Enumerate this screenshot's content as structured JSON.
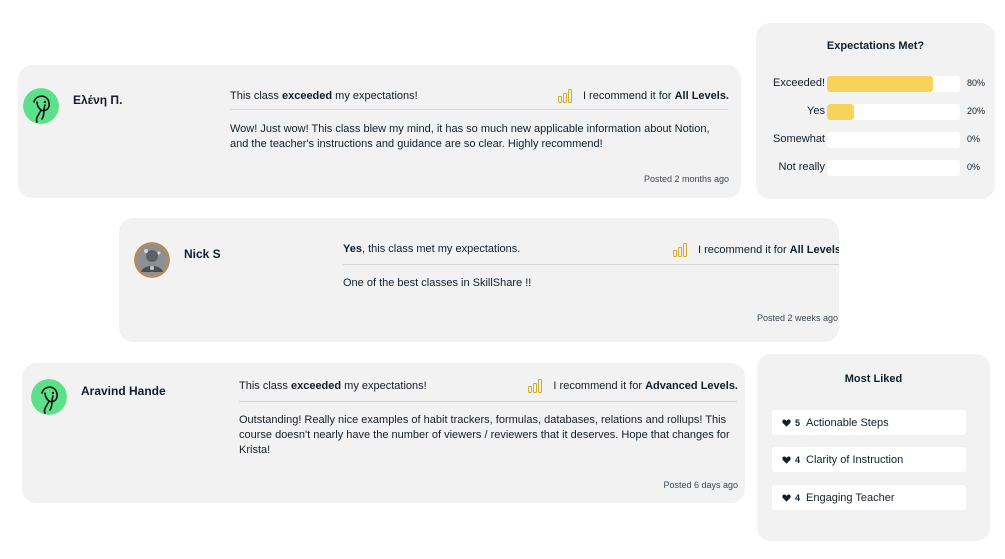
{
  "reviews": [
    {
      "author": "Ελένη Π.",
      "headline_pre": "This class ",
      "headline_bold": "exceeded",
      "headline_post": " my expectations!",
      "recommend_pre": "I recommend it for",
      "recommend_bold": "All Levels.",
      "body": "Wow! Just wow! This class blew my mind, it has so much new applicable information about Notion, and the teacher's instructions and guidance are so clear. Highly recommend!",
      "posted": "Posted 2 months ago"
    },
    {
      "author": "Nick S",
      "headline_pre": "",
      "headline_bold": "Yes",
      "headline_post": ", this class met my expectations.",
      "recommend_pre": "I recommend it for",
      "recommend_bold": "All Levels.",
      "body": "One of the best classes in SkillShare !!",
      "posted": "Posted 2 weeks ago"
    },
    {
      "author": "Aravind Hande",
      "headline_pre": "This class ",
      "headline_bold": "exceeded",
      "headline_post": " my expectations!",
      "recommend_pre": "I recommend it for",
      "recommend_bold": "Advanced Levels.",
      "body": "Outstanding! Really nice examples of habit trackers, formulas, databases, relations and rollups! This course doesn't nearly have the number of viewers / reviewers that it deserves. Hope that changes for Krista!",
      "posted": "Posted 6 days ago"
    }
  ],
  "expectations": {
    "title": "Expectations Met?",
    "bar_color": "#f6d35a",
    "rows": [
      {
        "label": "Exceeded!",
        "percent": 80,
        "display": "80%"
      },
      {
        "label": "Yes",
        "percent": 20,
        "display": "20%"
      },
      {
        "label": "Somewhat",
        "percent": 0,
        "display": "0%"
      },
      {
        "label": "Not really",
        "percent": 0,
        "display": "0%"
      }
    ]
  },
  "most_liked": {
    "title": "Most Liked",
    "items": [
      {
        "count": "5",
        "label": "Actionable Steps"
      },
      {
        "count": "4",
        "label": "Clarity of Instruction"
      },
      {
        "count": "4",
        "label": "Engaging Teacher"
      }
    ]
  },
  "icons": {
    "level": "signal-bars-icon",
    "heart": "heart-icon",
    "avatar_line_art": "line-art-face-avatar",
    "avatar_photo": "user-photo-avatar"
  },
  "colors": {
    "card_bg": "#f2f2f2",
    "avatar_green": "#5ce08a",
    "level_icon": "#d4aa1e"
  }
}
